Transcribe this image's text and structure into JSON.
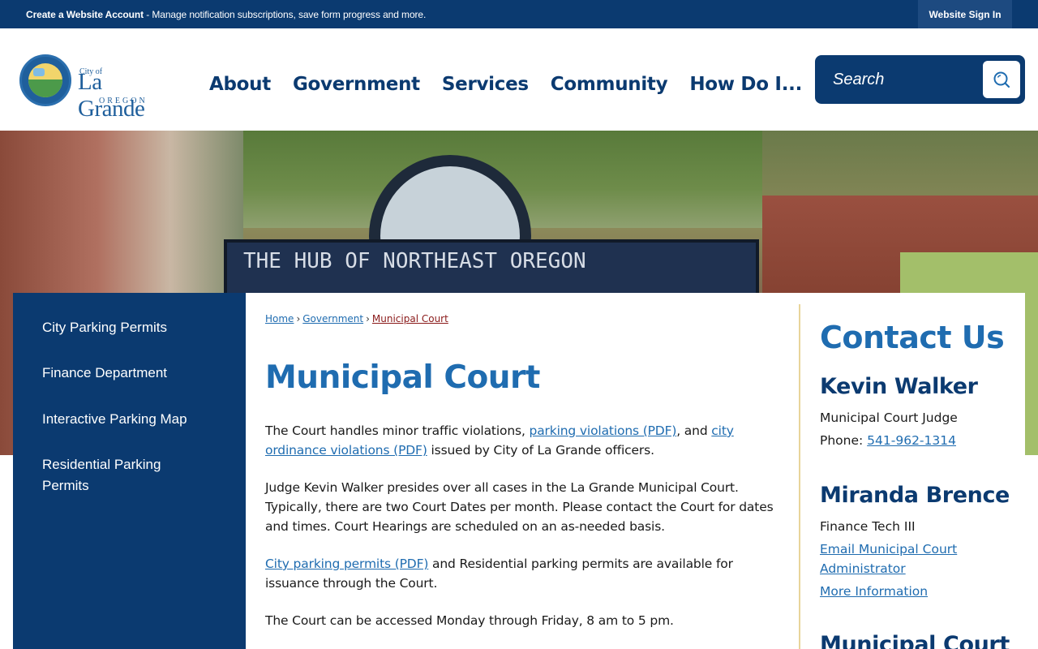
{
  "topbar": {
    "account_strong": "Create a Website Account",
    "account_rest": " - Manage notification subscriptions, save form progress and more.",
    "signin_label": "Website Sign In"
  },
  "logo": {
    "city_of": "City of",
    "name": "La Grande",
    "state": "OREGON"
  },
  "nav": {
    "items": [
      "About",
      "Government",
      "Services",
      "Community",
      "How Do I..."
    ]
  },
  "search": {
    "placeholder": "Search",
    "icon": "search-icon"
  },
  "hero": {
    "sign_text": "THE HUB OF NORTHEAST OREGON"
  },
  "sidebar": {
    "items": [
      "City Parking Permits",
      "Finance Department",
      "Interactive Parking Map",
      "Residential Parking Permits"
    ]
  },
  "breadcrumb": {
    "items": [
      "Home",
      "Government",
      "Municipal Court"
    ],
    "separator": "›"
  },
  "page": {
    "title": "Municipal Court",
    "p1_a": "The Court handles minor traffic violations, ",
    "p1_link1": "parking violations (PDF)",
    "p1_b": ", and ",
    "p1_link2": "city ordinance violations (PDF)",
    "p1_c": " issued by City of La Grande officers.",
    "p2": "Judge Kevin Walker presides over all cases in the La Grande Municipal Court. Typically, there are two Court Dates per month. Please contact the Court for dates and times. Court Hearings are scheduled on an as-needed basis.",
    "p3_link": "City parking permits (PDF)",
    "p3_rest": " and Residential parking permits are available for issuance through the Court.",
    "p4": "The Court can be accessed Monday through Friday, 8 am to 5 pm."
  },
  "contact": {
    "heading": "Contact Us",
    "person1": {
      "name": "Kevin Walker",
      "title": "Municipal Court Judge",
      "phone_label": "Phone: ",
      "phone": "541-962-1314"
    },
    "person2": {
      "name": "Miranda Brence",
      "title": "Finance Tech III",
      "email_line1": "Email Municipal Court",
      "email_line2": "Administrator",
      "more": "More Information"
    },
    "section3": "Municipal Court"
  },
  "colors": {
    "navy": "#0b3a70",
    "link_blue": "#1f6cb0",
    "breadcrumb_current": "#8a1a1a",
    "divider_gold": "#e8d49a"
  }
}
